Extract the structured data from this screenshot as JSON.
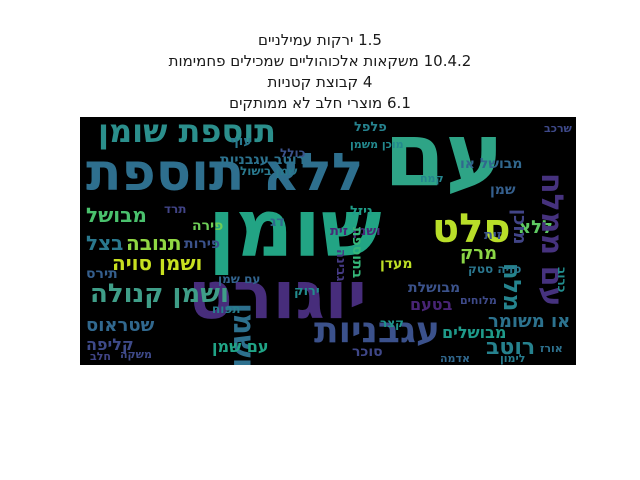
{
  "title_lines": [
    "1.5 ירקות עמילניים",
    "10.4.2 משקאות אלכוהוליים שמכילים פחמימות",
    "4 קבוצת קטניות",
    "6.1 מוצרי חלב לא ממותקים"
  ],
  "words": [
    {
      "text": "עם",
      "color": "#2ea486"
    },
    {
      "text": "שומן",
      "color": "#22a484"
    },
    {
      "text": "ללא תוספת",
      "color": "#2e6f8e"
    },
    {
      "text": "יוגורט",
      "color": "#472d7b"
    },
    {
      "text": "תוספת שומן",
      "color": "#2b8f8c"
    },
    {
      "text": "עגבניות",
      "color": "#3b518b"
    },
    {
      "text": "ושמן",
      "color": "#2d708e"
    },
    {
      "text": "סלט",
      "color": "#b8de29"
    },
    {
      "text": "ושמן קנולה",
      "color": "#3f9e88"
    },
    {
      "text": "מבושל",
      "color": "#4ac16d"
    },
    {
      "text": "תנובה",
      "color": "#90d743"
    },
    {
      "text": "בצל",
      "color": "#2a788e"
    },
    {
      "text": "ושמן סויה",
      "color": "#c8e020"
    },
    {
      "text": "שטראוס",
      "color": "#31688e"
    },
    {
      "text": "קליפה",
      "color": "#3e4a89"
    },
    {
      "text": "רוטב",
      "color": "#26828e"
    },
    {
      "text": "מבושלים",
      "color": "#1f9a8a"
    },
    {
      "text": "מרק",
      "color": "#8bd646"
    },
    {
      "text": "ללא",
      "color": "#5ec962"
    },
    {
      "text": "מוכן",
      "color": "#414487"
    },
    {
      "text": "בטעם",
      "color": "#482475"
    },
    {
      "text": "או משומר",
      "color": "#2c728e"
    },
    {
      "text": "תירס",
      "color": "#355f8d"
    },
    {
      "text": "פירות",
      "color": "#3b528b"
    },
    {
      "text": "מלח",
      "color": "#25848e"
    },
    {
      "text": "עם ממלח",
      "color": "#46327e"
    },
    {
      "text": "עם שמן",
      "color": "#20a486"
    },
    {
      "text": "רוטב עגבניות",
      "color": "#2c728e"
    },
    {
      "text": "ושמן זית",
      "color": "#482878"
    },
    {
      "text": "מבושל או",
      "color": "#31688e"
    },
    {
      "text": "מבושלת",
      "color": "#3b528b"
    },
    {
      "text": "ירוק",
      "color": "#228c8d"
    },
    {
      "text": "סוכר",
      "color": "#3f4788"
    },
    {
      "text": "פלפל",
      "color": "#26828e"
    },
    {
      "text": "בתוספת",
      "color": "#35b779"
    },
    {
      "text": "סויה סטק",
      "color": "#2a768e"
    },
    {
      "text": "מעדן",
      "color": "#bddf26"
    },
    {
      "text": "דג",
      "color": "#31688e"
    },
    {
      "text": "ניזל",
      "color": "#1f9e89"
    },
    {
      "text": "גבינה",
      "color": "#443a83"
    },
    {
      "text": "פירה",
      "color": "#6ece58"
    },
    {
      "text": "משקה",
      "color": "#3e4989"
    },
    {
      "text": "עוף",
      "color": "#2a788e"
    },
    {
      "text": "כולל",
      "color": "#3b528b"
    },
    {
      "text": "שמן בישול",
      "color": "#29798e"
    },
    {
      "text": "מוכן משמן",
      "color": "#23898e"
    },
    {
      "text": "שמן",
      "color": "#355f8d"
    },
    {
      "text": "זית",
      "color": "#3b528b"
    },
    {
      "text": "לימון",
      "color": "#287c8e"
    },
    {
      "text": "עם שמן",
      "color": "#32648e"
    },
    {
      "text": "חלב",
      "color": "#414487"
    },
    {
      "text": "תפוח",
      "color": "#277f8e"
    },
    {
      "text": "שרכב",
      "color": "#3e4989"
    },
    {
      "text": "קצר",
      "color": "#1f968b"
    },
    {
      "text": "אורז",
      "color": "#2d718e"
    },
    {
      "text": "תרד",
      "color": "#414487"
    },
    {
      "text": "כרוב",
      "color": "#228d8d"
    },
    {
      "text": "אדמה",
      "color": "#31688e"
    },
    {
      "text": "מלוחים",
      "color": "#3e4a89"
    },
    {
      "text": "קמח",
      "color": "#25858e"
    }
  ]
}
